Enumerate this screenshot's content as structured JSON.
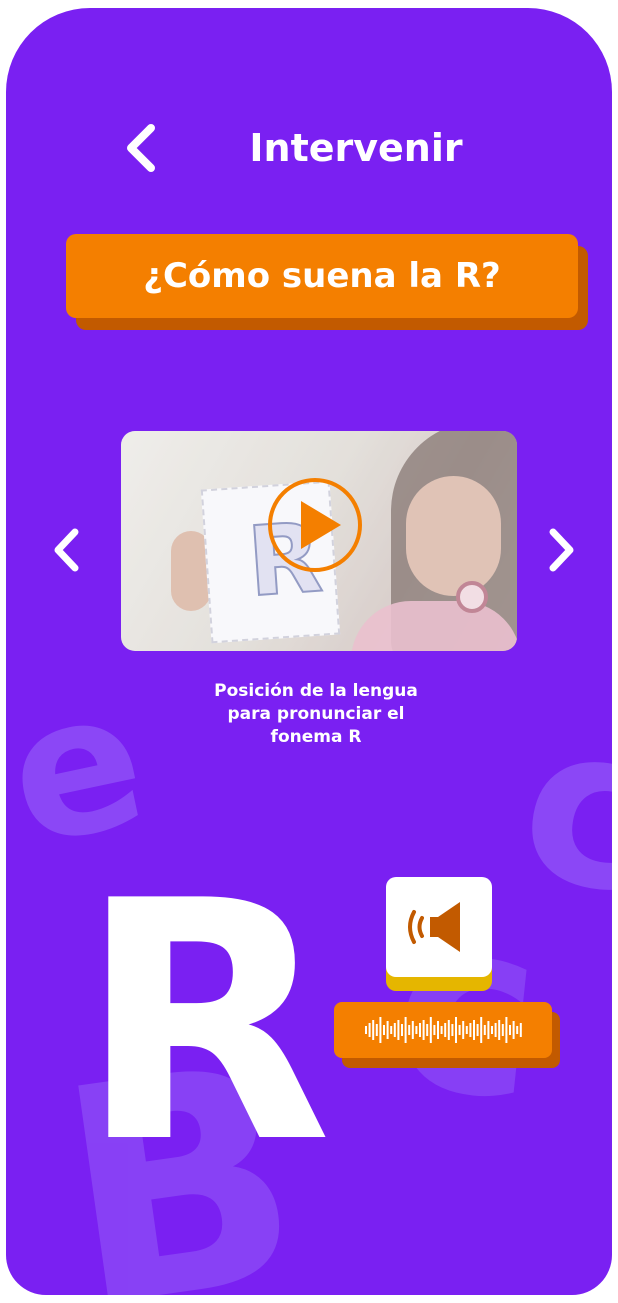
{
  "header": {
    "title": "Intervenir",
    "back_icon": "chevron-left-icon"
  },
  "banner": {
    "text": "¿Cómo suena la R?"
  },
  "video": {
    "play_icon": "play-icon",
    "card_letter": "R"
  },
  "carousel": {
    "prev_icon": "chevron-left-icon",
    "next_icon": "chevron-right-icon"
  },
  "caption": "Posición de la lengua\npara pronunciar el\nfonema R",
  "letter": "R",
  "audio": {
    "speaker_icon": "speaker-icon",
    "waveform_icon": "waveform-icon"
  },
  "colors": {
    "background": "#7a20f2",
    "accent_orange": "#f47f00",
    "accent_orange_shadow": "#c25a00",
    "speaker_shadow": "#e5b600",
    "speaker_icon": "#c25a00"
  }
}
